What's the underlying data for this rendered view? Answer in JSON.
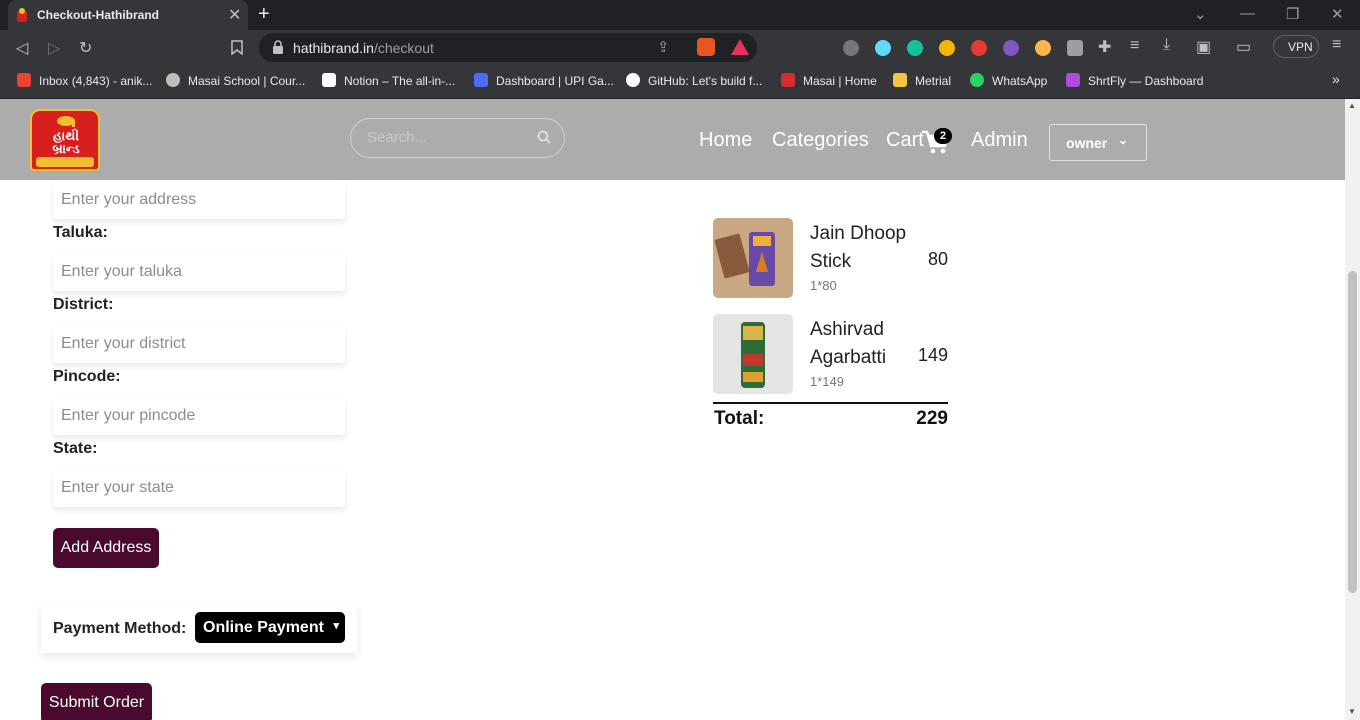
{
  "browser": {
    "tab_title": "Checkout-Hathibrand",
    "tab_close": "✕",
    "new_tab": "+",
    "url_host": "hathibrand.in",
    "url_path": "/checkout",
    "vpn_label": "VPN",
    "bookmarks": [
      {
        "label": "Inbox (4,843) - anik...",
        "color": "#ea4335"
      },
      {
        "label": "Masai School | Cour...",
        "color": "#bdbdbd"
      },
      {
        "label": "Notion – The all-in-...",
        "color": "#ffffff"
      },
      {
        "label": "Dashboard | UPI Ga...",
        "color": "#4a6cf7"
      },
      {
        "label": "GitHub: Let's build f...",
        "color": "#ffffff"
      },
      {
        "label": "Masai | Home",
        "color": "#d32f2f"
      },
      {
        "label": "Metrial",
        "color": "#f4c542"
      },
      {
        "label": "WhatsApp",
        "color": "#25d366"
      },
      {
        "label": "ShrtFly — Dashboard",
        "color": "#b04be0"
      }
    ],
    "more_bookmarks": "»"
  },
  "header": {
    "logo_text": "હાથી\nબ્રાન્ડ",
    "search_placeholder": "Search...",
    "nav": {
      "home": "Home",
      "categories": "Categories",
      "cart": "Cart",
      "cart_count": "2",
      "admin": "Admin"
    },
    "user_menu": "owner"
  },
  "form": {
    "address_placeholder": "Enter your address",
    "taluka_label": "Taluka:",
    "taluka_placeholder": "Enter your taluka",
    "district_label": "District:",
    "district_placeholder": "Enter your district",
    "pincode_label": "Pincode:",
    "pincode_placeholder": "Enter your pincode",
    "state_label": "State:",
    "state_placeholder": "Enter your state",
    "add_address_button": "Add Address",
    "payment_label": "Payment Method:",
    "payment_selected": "Online Payment",
    "submit_button": "Submit Order"
  },
  "cart": {
    "items": [
      {
        "name": "Jain Dhoop Stick",
        "qty": "1*80",
        "price": "80"
      },
      {
        "name": "Ashirvad Agarbatti",
        "qty": "1*149",
        "price": "149"
      }
    ],
    "total_label": "Total:",
    "total_value": "229"
  }
}
